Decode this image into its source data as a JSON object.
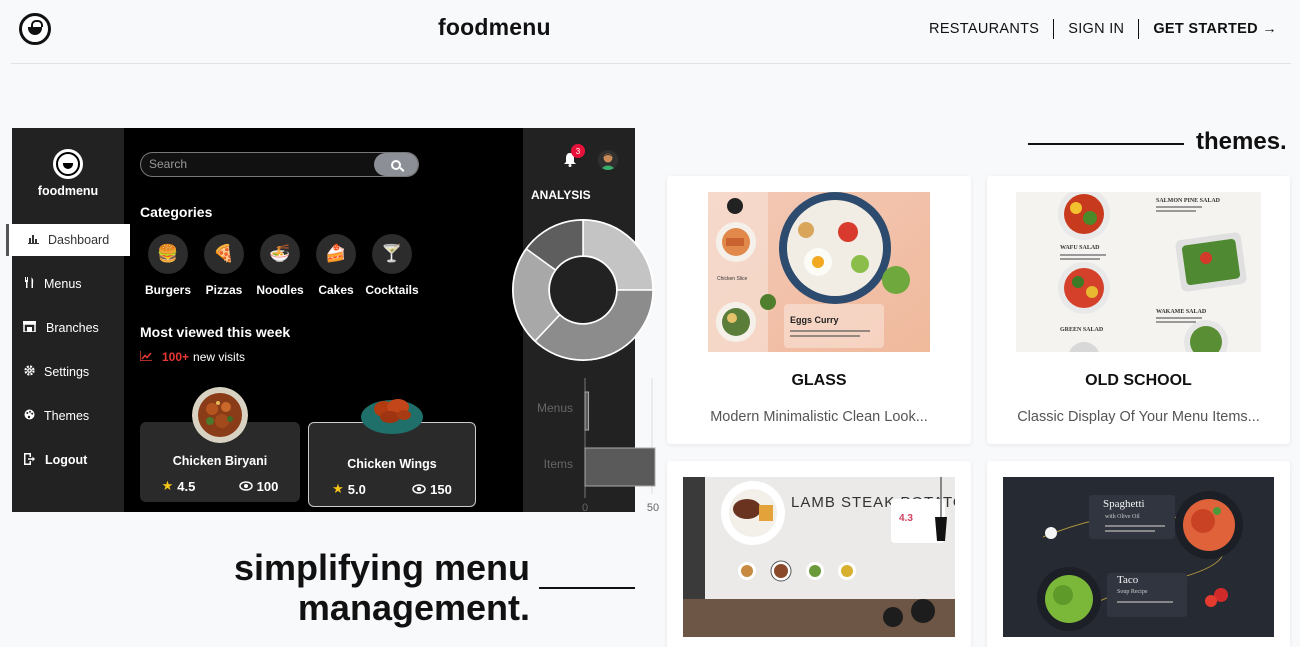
{
  "header": {
    "brand": "foodmenu",
    "nav": {
      "restaurants": "RESTAURANTS",
      "signin": "SIGN IN",
      "get_started": "GET STARTED →"
    }
  },
  "dashboard": {
    "brand": "foodmenu",
    "sidebar": [
      {
        "label": "Dashboard",
        "icon": "chart-icon"
      },
      {
        "label": "Menus",
        "icon": "utensils-icon"
      },
      {
        "label": "Branches",
        "icon": "store-icon"
      },
      {
        "label": "Settings",
        "icon": "gear-icon"
      },
      {
        "label": "Themes",
        "icon": "palette-icon"
      },
      {
        "label": "Logout",
        "icon": "logout-icon"
      }
    ],
    "search": {
      "placeholder": "Search"
    },
    "categories_title": "Categories",
    "categories": [
      {
        "label": "Burgers",
        "glyph": "🍔"
      },
      {
        "label": "Pizzas",
        "glyph": "🍕"
      },
      {
        "label": "Noodles",
        "glyph": "🍜"
      },
      {
        "label": "Cakes",
        "glyph": "🍰"
      },
      {
        "label": "Cocktails",
        "glyph": "🍸"
      }
    ],
    "most_viewed_title": "Most viewed this week",
    "visits": {
      "count": "100+",
      "text": "new visits"
    },
    "dishes": [
      {
        "name": "Chicken Biryani",
        "rating": "4.5",
        "views": "100"
      },
      {
        "name": "Chicken Wings",
        "rating": "5.0",
        "views": "150"
      }
    ],
    "notifications": "3",
    "analysis_title": "ANALYSIS",
    "donut": [
      {
        "value": 25,
        "color": "#c4c4c4"
      },
      {
        "value": 37,
        "color": "#8c8c8c"
      },
      {
        "value": 23,
        "color": "#a8a8a8"
      },
      {
        "value": 15,
        "color": "#5e5e5e"
      }
    ],
    "bars": {
      "categories": [
        "Menus",
        "Items"
      ],
      "values": [
        1,
        22
      ],
      "xmin_label": "0",
      "xmax_label": "50",
      "xmax": 50
    }
  },
  "tagline": {
    "line1": "simplifying menu",
    "line2": "management."
  },
  "themes": {
    "title": "themes.",
    "cards": [
      {
        "name": "GLASS",
        "desc": "Modern Minimalistic Clean Look..."
      },
      {
        "name": "OLD SCHOOL",
        "desc": "Classic Display Of Your Menu Items..."
      },
      {
        "name": "",
        "desc": "",
        "overlay": "LAMB STEAK POTATO",
        "rating": "4.3"
      },
      {
        "name": "",
        "desc": "",
        "overlay1": "Spaghetti",
        "overlay1_sub": "with Olive Oil",
        "overlay2": "Taco",
        "overlay2_sub": "Soup Recipe"
      }
    ]
  }
}
